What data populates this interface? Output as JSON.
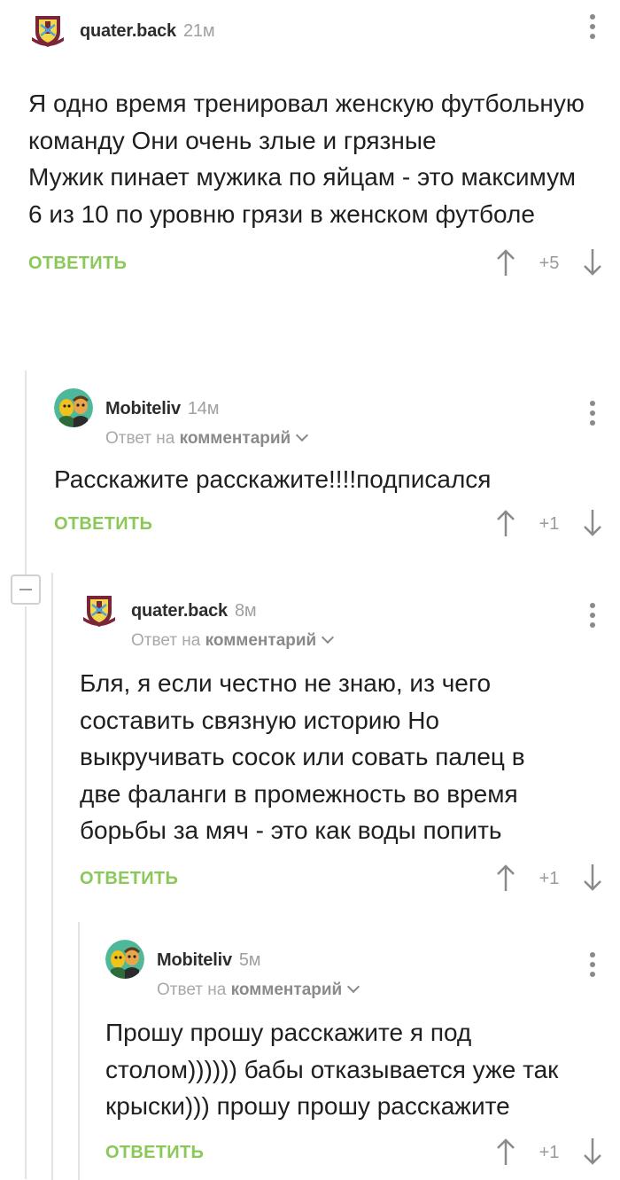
{
  "comments": [
    {
      "author": "quater.back",
      "time": "21м",
      "reply_prefix": "",
      "reply_target": "",
      "text": "Я одно время тренировал женскую футбольную команду Они очень злые и грязные\nМужик пинает мужика по яйцам - это максимум 6 из 10 по уровню грязи в женском футболе",
      "reply_label": "ОТВЕТИТЬ",
      "score": "+5",
      "avatar_icon": "west-ham-crest-icon"
    },
    {
      "author": "Mobiteliv",
      "time": "14м",
      "reply_prefix": "Ответ на",
      "reply_target": "комментарий",
      "text": "Расскажите расскажите!!!!подписался",
      "reply_label": "ОТВЕТИТЬ",
      "score": "+1",
      "avatar_icon": "cartoon-characters-icon"
    },
    {
      "author": "quater.back",
      "time": "8м",
      "reply_prefix": "Ответ на",
      "reply_target": "комментарий",
      "text": "Бля, я если честно не знаю, из чего составить связную историю Но выкручивать сосок или совать палец в две фаланги в промежность во время борьбы за мяч - это как воды попить",
      "reply_label": "ОТВЕТИТЬ",
      "score": "+1",
      "avatar_icon": "west-ham-crest-icon"
    },
    {
      "author": "Mobiteliv",
      "time": "5м",
      "reply_prefix": "Ответ на",
      "reply_target": "комментарий",
      "text": "Прошу прошу расскажите я под столом)))))) бабы отказывается уже так крыски))) прошу прошу расскажите",
      "reply_label": "ОТВЕТИТЬ",
      "score": "+1",
      "avatar_icon": "cartoon-characters-icon"
    }
  ],
  "colors": {
    "accent_green": "#8ac858",
    "text": "#1f1f1f",
    "muted": "#a0a0a0",
    "crest_claret": "#7a2638",
    "crest_blue": "#4fa3d8"
  }
}
